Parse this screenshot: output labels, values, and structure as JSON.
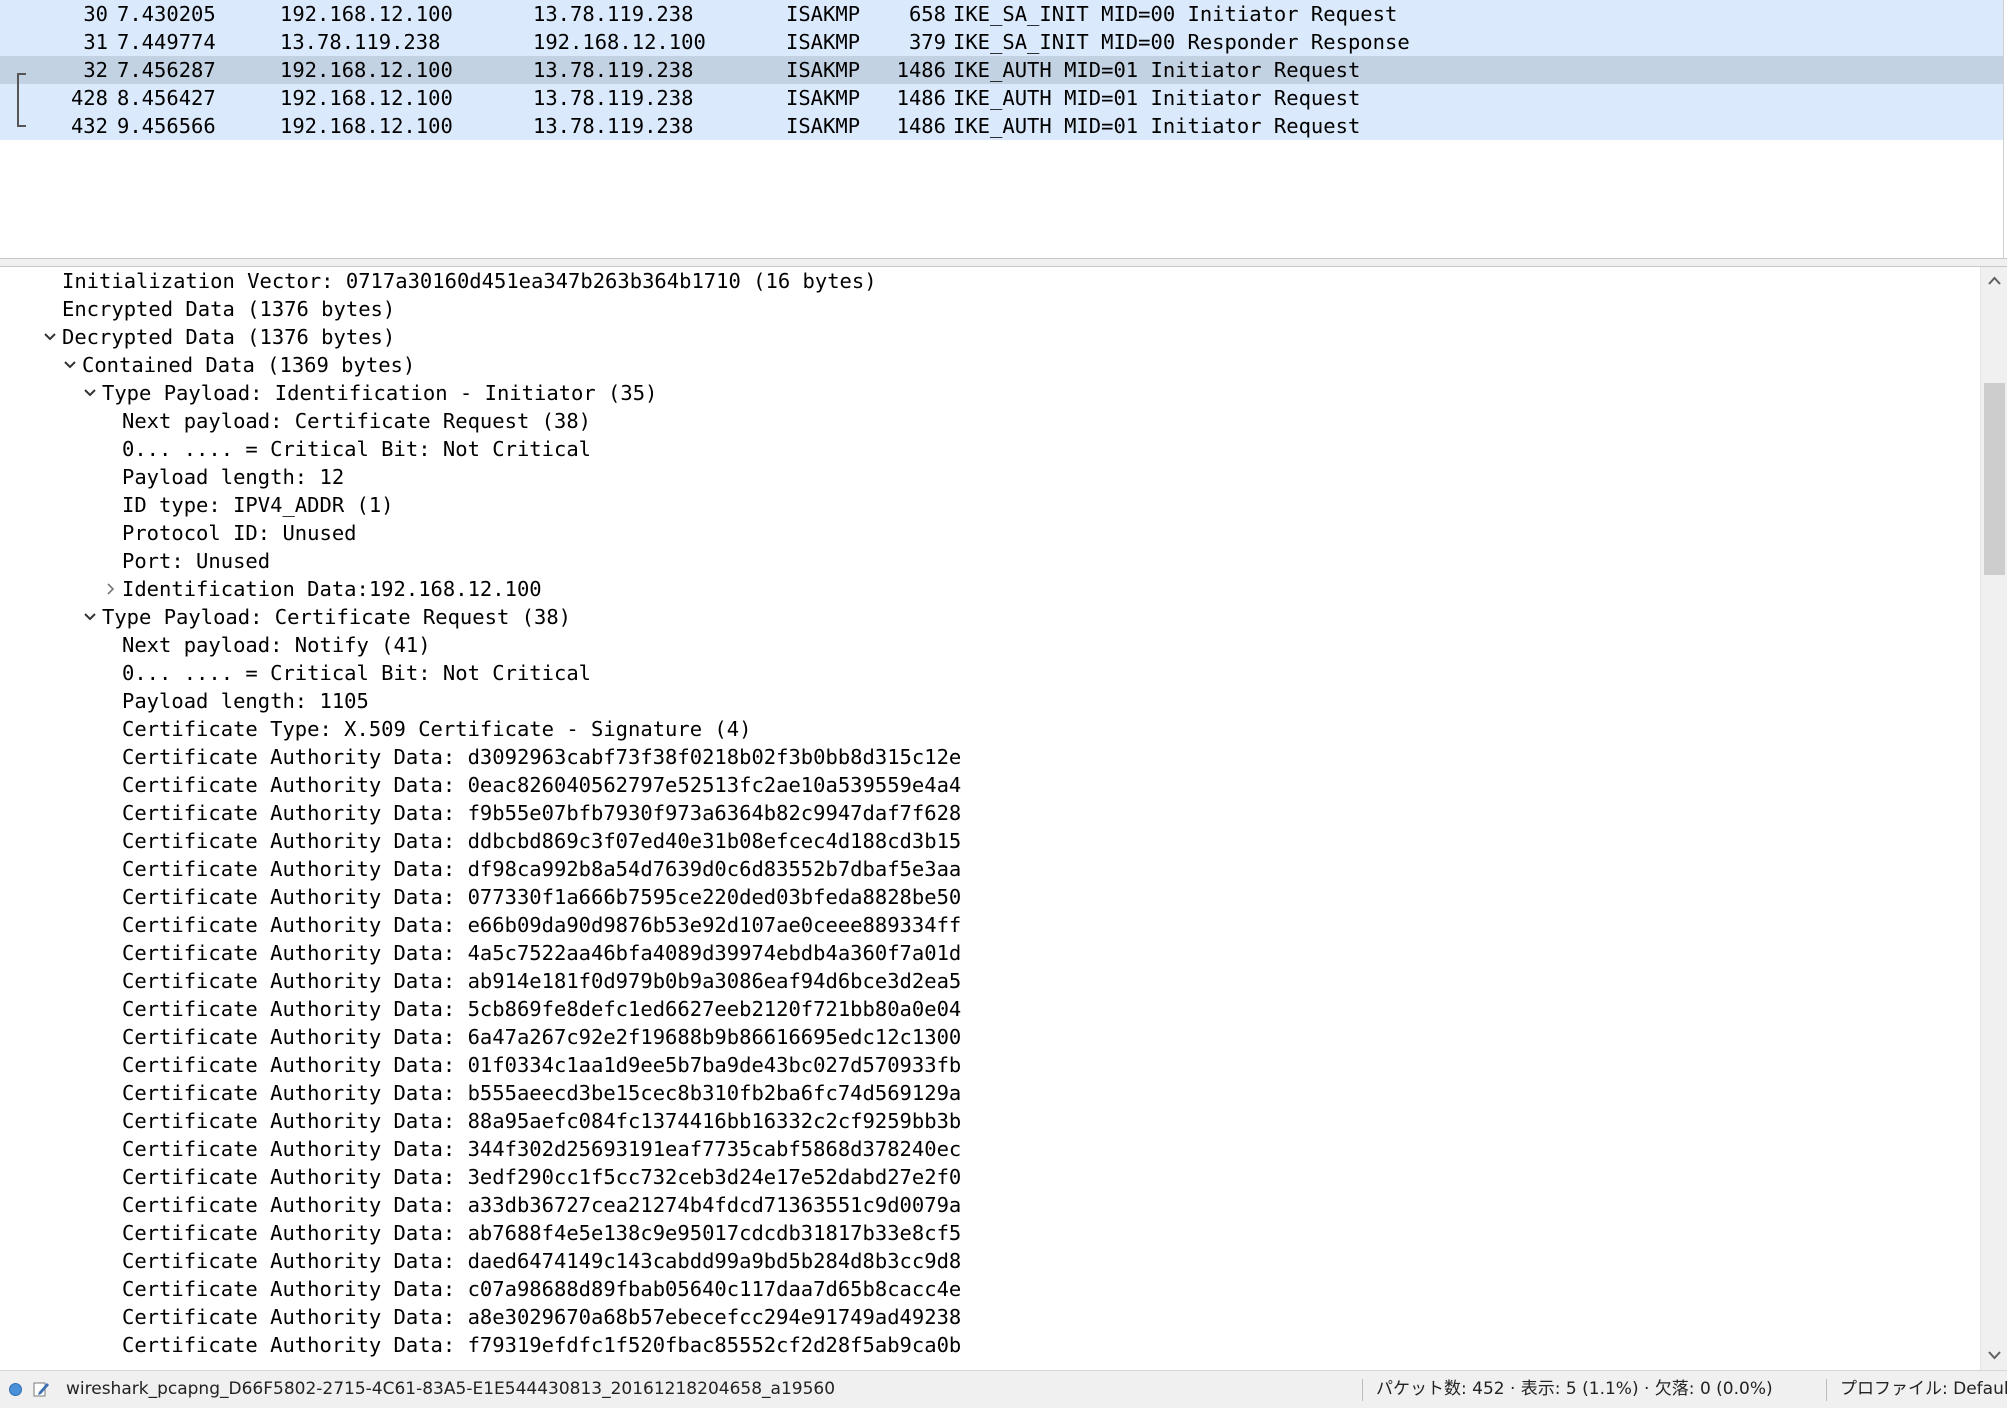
{
  "packet_list": {
    "rows": [
      {
        "no": "30",
        "time": "7.430205",
        "src": "192.168.12.100",
        "dst": "13.78.119.238",
        "proto": "ISAKMP",
        "len": "658",
        "info": "IKE_SA_INIT MID=00 Initiator Request",
        "selected": false
      },
      {
        "no": "31",
        "time": "7.449774",
        "src": "13.78.119.238",
        "dst": "192.168.12.100",
        "proto": "ISAKMP",
        "len": "379",
        "info": "IKE_SA_INIT MID=00 Responder Response",
        "selected": false
      },
      {
        "no": "32",
        "time": "7.456287",
        "src": "192.168.12.100",
        "dst": "13.78.119.238",
        "proto": "ISAKMP",
        "len": "1486",
        "info": "IKE_AUTH MID=01 Initiator Request",
        "selected": true
      },
      {
        "no": "428",
        "time": "8.456427",
        "src": "192.168.12.100",
        "dst": "13.78.119.238",
        "proto": "ISAKMP",
        "len": "1486",
        "info": "IKE_AUTH MID=01 Initiator Request",
        "selected": false
      },
      {
        "no": "432",
        "time": "9.456566",
        "src": "192.168.12.100",
        "dst": "13.78.119.238",
        "proto": "ISAKMP",
        "len": "1486",
        "info": "IKE_AUTH MID=01 Initiator Request",
        "selected": false
      }
    ]
  },
  "details": {
    "lines": [
      {
        "text": "Initialization Vector: 0717a30160d451ea347b263b364b1710 (16 bytes)",
        "level": 0,
        "twisty": "none"
      },
      {
        "text": "Encrypted Data (1376 bytes)",
        "level": 0,
        "twisty": "none"
      },
      {
        "text": "Decrypted Data (1376 bytes)",
        "level": 0,
        "twisty": "expanded"
      },
      {
        "text": "Contained Data (1369 bytes)",
        "level": 1,
        "twisty": "expanded"
      },
      {
        "text": "Type Payload: Identification - Initiator (35)",
        "level": 2,
        "twisty": "expanded"
      },
      {
        "text": "Next payload: Certificate Request (38)",
        "level": 3,
        "twisty": "none"
      },
      {
        "text": "0... .... = Critical Bit: Not Critical",
        "level": 3,
        "twisty": "none"
      },
      {
        "text": "Payload length: 12",
        "level": 3,
        "twisty": "none"
      },
      {
        "text": "ID type: IPV4_ADDR (1)",
        "level": 3,
        "twisty": "none"
      },
      {
        "text": "Protocol ID: Unused",
        "level": 3,
        "twisty": "none"
      },
      {
        "text": "Port: Unused",
        "level": 3,
        "twisty": "none"
      },
      {
        "text": "Identification Data:192.168.12.100",
        "level": 3,
        "twisty": "collapsed"
      },
      {
        "text": "Type Payload: Certificate Request (38)",
        "level": 2,
        "twisty": "expanded"
      },
      {
        "text": "Next payload: Notify (41)",
        "level": 3,
        "twisty": "none"
      },
      {
        "text": "0... .... = Critical Bit: Not Critical",
        "level": 3,
        "twisty": "none"
      },
      {
        "text": "Payload length: 1105",
        "level": 3,
        "twisty": "none"
      },
      {
        "text": "Certificate Type: X.509 Certificate - Signature (4)",
        "level": 3,
        "twisty": "none"
      },
      {
        "text": "Certificate Authority Data: d3092963cabf73f38f0218b02f3b0bb8d315c12e",
        "level": 3,
        "twisty": "none"
      },
      {
        "text": "Certificate Authority Data: 0eac826040562797e52513fc2ae10a539559e4a4",
        "level": 3,
        "twisty": "none"
      },
      {
        "text": "Certificate Authority Data: f9b55e07bfb7930f973a6364b82c9947daf7f628",
        "level": 3,
        "twisty": "none"
      },
      {
        "text": "Certificate Authority Data: ddbcbd869c3f07ed40e31b08efcec4d188cd3b15",
        "level": 3,
        "twisty": "none"
      },
      {
        "text": "Certificate Authority Data: df98ca992b8a54d7639d0c6d83552b7dbaf5e3aa",
        "level": 3,
        "twisty": "none"
      },
      {
        "text": "Certificate Authority Data: 077330f1a666b7595ce220ded03bfeda8828be50",
        "level": 3,
        "twisty": "none"
      },
      {
        "text": "Certificate Authority Data: e66b09da90d9876b53e92d107ae0ceee889334ff",
        "level": 3,
        "twisty": "none"
      },
      {
        "text": "Certificate Authority Data: 4a5c7522aa46bfa4089d39974ebdb4a360f7a01d",
        "level": 3,
        "twisty": "none"
      },
      {
        "text": "Certificate Authority Data: ab914e181f0d979b0b9a3086eaf94d6bce3d2ea5",
        "level": 3,
        "twisty": "none"
      },
      {
        "text": "Certificate Authority Data: 5cb869fe8defc1ed6627eeb2120f721bb80a0e04",
        "level": 3,
        "twisty": "none"
      },
      {
        "text": "Certificate Authority Data: 6a47a267c92e2f19688b9b86616695edc12c1300",
        "level": 3,
        "twisty": "none"
      },
      {
        "text": "Certificate Authority Data: 01f0334c1aa1d9ee5b7ba9de43bc027d570933fb",
        "level": 3,
        "twisty": "none"
      },
      {
        "text": "Certificate Authority Data: b555aeecd3be15cec8b310fb2ba6fc74d569129a",
        "level": 3,
        "twisty": "none"
      },
      {
        "text": "Certificate Authority Data: 88a95aefc084fc1374416bb16332c2cf9259bb3b",
        "level": 3,
        "twisty": "none"
      },
      {
        "text": "Certificate Authority Data: 344f302d25693191eaf7735cabf5868d378240ec",
        "level": 3,
        "twisty": "none"
      },
      {
        "text": "Certificate Authority Data: 3edf290cc1f5cc732ceb3d24e17e52dabd27e2f0",
        "level": 3,
        "twisty": "none"
      },
      {
        "text": "Certificate Authority Data: a33db36727cea21274b4fdcd71363551c9d0079a",
        "level": 3,
        "twisty": "none"
      },
      {
        "text": "Certificate Authority Data: ab7688f4e5e138c9e95017cdcdb31817b33e8cf5",
        "level": 3,
        "twisty": "none"
      },
      {
        "text": "Certificate Authority Data: daed6474149c143cabdd99a9bd5b284d8b3cc9d8",
        "level": 3,
        "twisty": "none"
      },
      {
        "text": "Certificate Authority Data: c07a98688d89fbab05640c117daa7d65b8cacc4e",
        "level": 3,
        "twisty": "none"
      },
      {
        "text": "Certificate Authority Data: a8e3029670a68b57ebecefcc294e91749ad49238",
        "level": 3,
        "twisty": "none"
      },
      {
        "text": "Certificate Authority Data: f79319efdfc1f520fbac85552cf2d28f5ab9ca0b",
        "level": 3,
        "twisty": "none"
      }
    ]
  },
  "statusbar": {
    "file": "wireshark_pcapng_D66F5802-2715-4C61-83A5-E1E544430813_20161218204658_a19560",
    "stats": "パケット数: 452 · 表示: 5 (1.1%) · 欠落: 0 (0.0%)",
    "profile": "プロファイル: Default"
  },
  "colors": {
    "row_bg": "#dae9fb",
    "row_selected_bg": "#c3d2e3",
    "status_icon": "#4a90d9"
  },
  "icons": {
    "expanded": "chevron-down-icon",
    "collapsed": "chevron-right-icon",
    "scroll_up": "scroll-up-arrow-icon",
    "scroll_down": "scroll-down-arrow-icon",
    "status": "ready-status-icon",
    "edit": "edit-comment-icon"
  }
}
